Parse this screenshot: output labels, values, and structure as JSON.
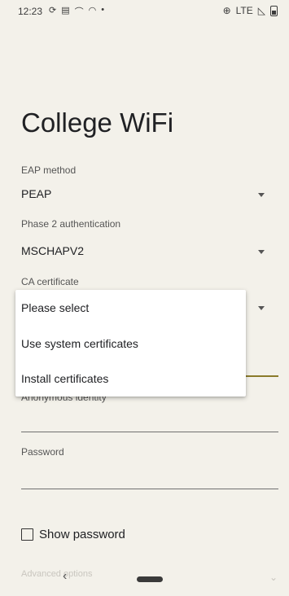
{
  "status_bar": {
    "time": "12:23",
    "left_icons": [
      "sync-icon",
      "screencast-icon",
      "cloud-icon",
      "wifi-icon",
      "dot-icon"
    ],
    "network": "LTE",
    "right_icons": [
      "data-saver-icon",
      "signal-icon",
      "battery-icon"
    ]
  },
  "page": {
    "title": "College WiFi"
  },
  "form": {
    "eap_method": {
      "label": "EAP method",
      "value": "PEAP"
    },
    "phase2": {
      "label": "Phase 2 authentication",
      "value": "MSCHAPV2"
    },
    "ca_certificate": {
      "label": "CA certificate"
    },
    "anonymous_identity": {
      "label": "Anonymous identity"
    },
    "password": {
      "label": "Password"
    },
    "show_password": {
      "label": "Show password",
      "checked": false
    },
    "advanced_options": {
      "label": "Advanced options"
    }
  },
  "dropdown": {
    "options": [
      "Please select",
      "Use system certificates",
      "Install certificates"
    ]
  },
  "nav": {
    "back_glyph": "‹"
  }
}
